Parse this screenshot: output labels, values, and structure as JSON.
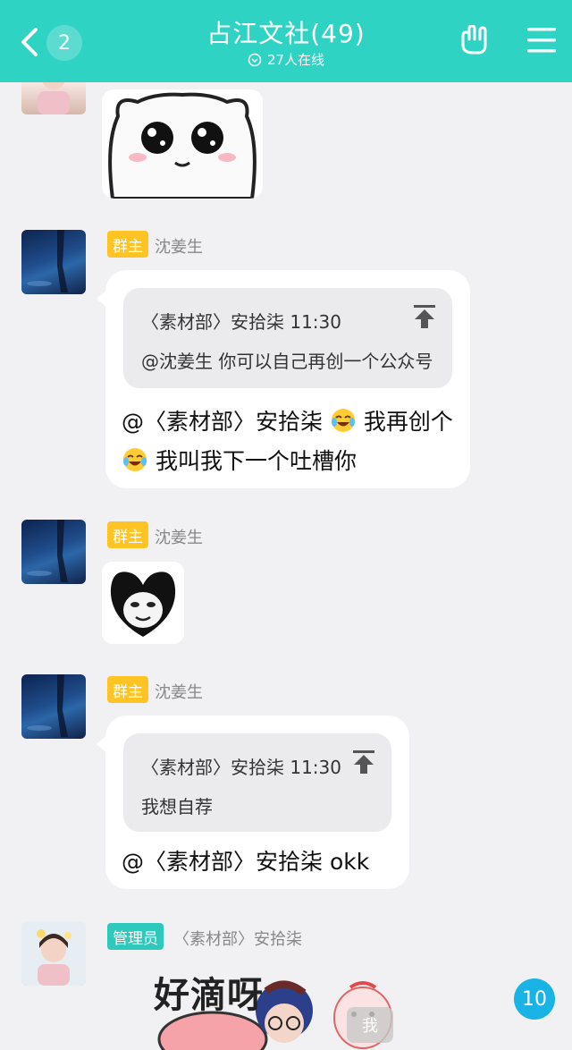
{
  "header": {
    "back_count": "2",
    "title": "占江文社(49)",
    "online": "27人在线",
    "bg_color": "#2fd3c4"
  },
  "messages": [
    {
      "role_badge": "群主",
      "sender": "沈姜生",
      "quote": {
        "head": "〈素材部〉安拾柒 11:30",
        "body": "@沈姜生 你可以自己再创一个公众号"
      },
      "line1": "@〈素材部〉安拾柒",
      "line1_after": "我再创个",
      "line2": "我叫我下一个吐槽你",
      "emoji": "tears-of-joy-emoji"
    },
    {
      "role_badge": "群主",
      "sender": "沈姜生",
      "sticker": "panda-meme-sticker"
    },
    {
      "role_badge": "群主",
      "sender": "沈姜生",
      "quote": {
        "head": "〈素材部〉安拾柒 11:30",
        "body": "我想自荐"
      },
      "line1": "@〈素材部〉安拾柒 okk"
    },
    {
      "role_badge": "管理员",
      "sender": "〈素材部〉安拾柒",
      "sticker_text": "好滴呀",
      "me_tag": "我"
    }
  ],
  "fab_count": "10"
}
